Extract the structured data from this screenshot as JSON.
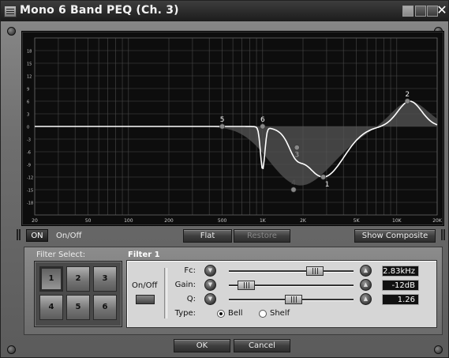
{
  "window": {
    "title": "Mono 6 Band PEQ (Ch. 3)",
    "close_glyph": "✕"
  },
  "graph": {
    "y_ticks": [
      "18",
      "15",
      "12",
      "9",
      "6",
      "3",
      "0",
      "-3",
      "-6",
      "-9",
      "-12",
      "-15",
      "-18"
    ],
    "x_ticks": [
      "20",
      "50",
      "100",
      "200",
      "500",
      "1K",
      "2K",
      "5K",
      "10K",
      "20K"
    ],
    "x_ticks_hz": [
      20,
      50,
      100,
      200,
      500,
      1000,
      2000,
      5000,
      10000,
      20000
    ],
    "y_range": [
      -21,
      21
    ],
    "band_markers": [
      {
        "label": "1",
        "freq": 2830,
        "gain": -12
      },
      {
        "label": "2",
        "freq": 12000,
        "gain": 6
      },
      {
        "label": "3",
        "freq": 1800,
        "gain": -5
      },
      {
        "label": "4",
        "freq": 1700,
        "gain": -15
      },
      {
        "label": "5",
        "freq": 500,
        "gain": 0
      },
      {
        "label": "6",
        "freq": 1000,
        "gain": 0
      }
    ],
    "colors": {
      "grid": "#4a4a4a",
      "curve": "#ffffff",
      "fill": "#555555"
    }
  },
  "controls": {
    "on_label": "ON",
    "onoff_label": "On/Off",
    "flat_label": "Flat",
    "restore_label": "Restore",
    "composite_label": "Show Composite"
  },
  "filter_select": {
    "label": "Filter Select:",
    "buttons": [
      "1",
      "2",
      "3",
      "4",
      "5",
      "6"
    ],
    "selected": "1"
  },
  "filter": {
    "title": "Filter 1",
    "onoff_label": "On/Off",
    "fc_label": "Fc:",
    "gain_label": "Gain:",
    "q_label": "Q:",
    "type_label": "Type:",
    "fc_value": "2.83kHz",
    "gain_value": "-12dB",
    "q_value": "1.26",
    "fc_level": 0.72,
    "gain_level": 0.08,
    "q_level": 0.52,
    "type_options": [
      "Bell",
      "Shelf"
    ],
    "type_selected": "Bell",
    "down_icon": "▼",
    "up_icon": "▲"
  },
  "footer": {
    "ok_label": "OK",
    "cancel_label": "Cancel"
  }
}
